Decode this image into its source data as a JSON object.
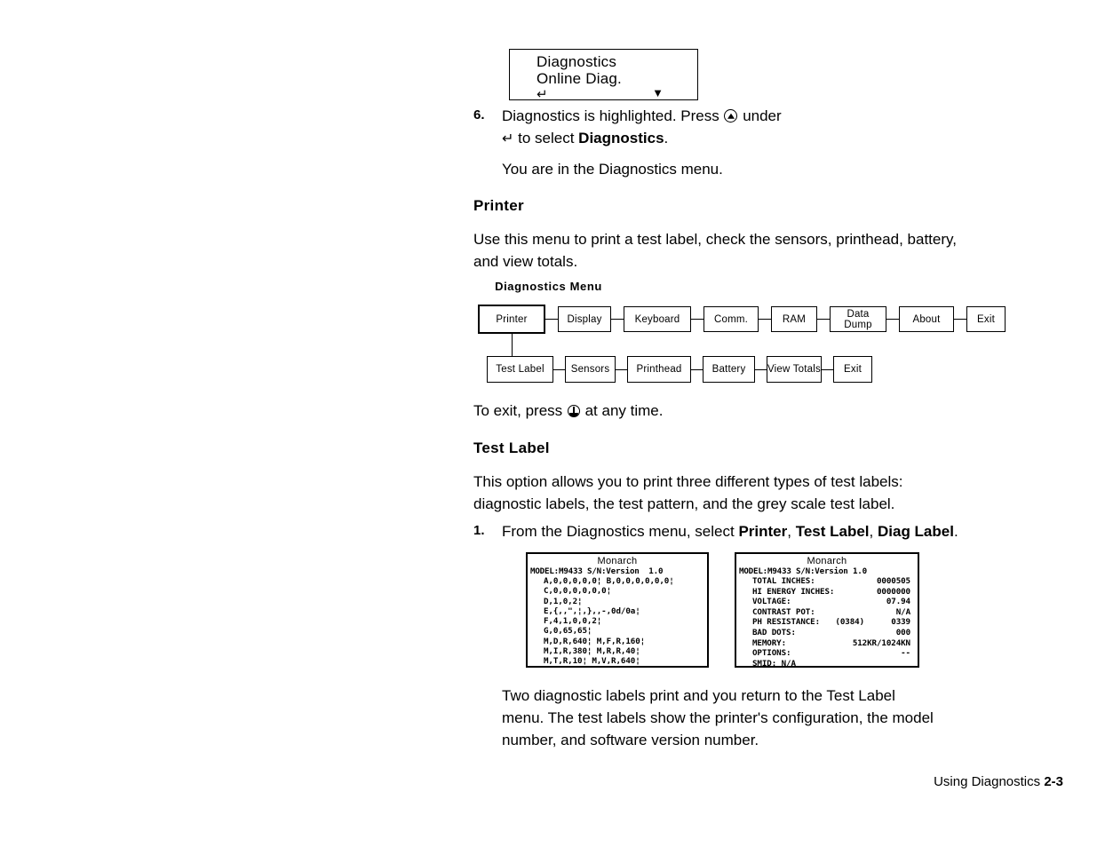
{
  "lcd": {
    "line1": "Diagnostics",
    "line2": "Online Diag.",
    "enter_glyph": "↵",
    "down_arrow": "▼"
  },
  "step6": {
    "number": "6.",
    "text_a": "Diagnostics is highlighted.  Press ",
    "text_b": " under",
    "text_c": " to select ",
    "bold_c": "Diagnostics",
    "text_d": ".",
    "enter_glyph": "↵"
  },
  "paragraphs": {
    "you_are_in": "You are in the Diagnostics menu.",
    "printer_intro_l1": "Use this menu to print a test label, check the sensors, printhead, battery,",
    "printer_intro_l2": "and view totals.",
    "to_exit_a": "To exit, press ",
    "to_exit_b": " at any time.",
    "test_label_intro_l1": "This option allows you to print three different types of test labels:",
    "test_label_intro_l2": "diagnostic labels, the test pattern, and the grey scale test label.",
    "two_labels_l1": "Two diagnostic labels print and you return to the Test Label",
    "two_labels_l2": "menu.  The test labels show the printer's configuration, the model",
    "two_labels_l3": "number, and software version number."
  },
  "headings": {
    "printer": "Printer",
    "test_label": "Test Label"
  },
  "step1": {
    "number": "1.",
    "text_a": "From the Diagnostics menu, select ",
    "bold_a": "Printer",
    "sep1": ", ",
    "bold_b": "Test Label",
    "sep2": ", ",
    "bold_c": "Diag Label",
    "text_end": "."
  },
  "menu_diagram": {
    "title": "Diagnostics Menu",
    "row1": [
      {
        "label": "Printer",
        "highlighted": true
      },
      {
        "label": "Display",
        "highlighted": false
      },
      {
        "label": "Keyboard",
        "highlighted": false
      },
      {
        "label": "Comm.",
        "highlighted": false
      },
      {
        "label": "RAM",
        "highlighted": false
      },
      {
        "label": "Data\nDump",
        "highlighted": false
      },
      {
        "label": "About",
        "highlighted": false
      },
      {
        "label": "Exit",
        "highlighted": false
      }
    ],
    "row2": [
      {
        "label": "Test Label",
        "highlighted": false
      },
      {
        "label": "Sensors",
        "highlighted": false
      },
      {
        "label": "Printhead",
        "highlighted": false
      },
      {
        "label": "Battery",
        "highlighted": false
      },
      {
        "label": "View Totals",
        "highlighted": false
      },
      {
        "label": "Exit",
        "highlighted": false
      }
    ]
  },
  "test_labels": {
    "left": {
      "title": "Monarch",
      "model": "MODEL:M9433 S/N:Version  1.0",
      "lines": [
        "A,0,0,0,0,0¦ B,0,0,0,0,0,0¦",
        "C,0,0,0,0,0,0¦",
        "D,1,0,2¦",
        "E,{,,\",¦,},,-,0d/0a¦",
        "F,4,1,0,0,2¦",
        "G,0,65,65¦",
        "M,D,R,640¦ M,F,R,160¦",
        "M,I,R,380¦ M,R,R,40¦",
        "M,T,R,10¦ M,V,R,640¦"
      ]
    },
    "right": {
      "title": "Monarch",
      "model": "MODEL:M9433 S/N:Version 1.0",
      "rows": [
        {
          "key": "TOTAL INCHES:",
          "mid": "",
          "value": "0000505"
        },
        {
          "key": "HI ENERGY INCHES:",
          "mid": "",
          "value": "0000000"
        },
        {
          "key": "VOLTAGE:",
          "mid": "",
          "value": "07.94"
        },
        {
          "key": "CONTRAST POT:",
          "mid": "",
          "value": "N/A"
        },
        {
          "key": "PH RESISTANCE:",
          "mid": "(0384)",
          "value": "0339"
        },
        {
          "key": "BAD DOTS:",
          "mid": "",
          "value": "000"
        },
        {
          "key": "MEMORY:",
          "mid": "",
          "value": "512KR/1024KN"
        },
        {
          "key": "OPTIONS:",
          "mid": "",
          "value": "--"
        },
        {
          "key": "SMID: N/A",
          "mid": "",
          "value": ""
        }
      ]
    }
  },
  "footer": {
    "chapter": "Using Diagnostics",
    "page": "2-3"
  }
}
